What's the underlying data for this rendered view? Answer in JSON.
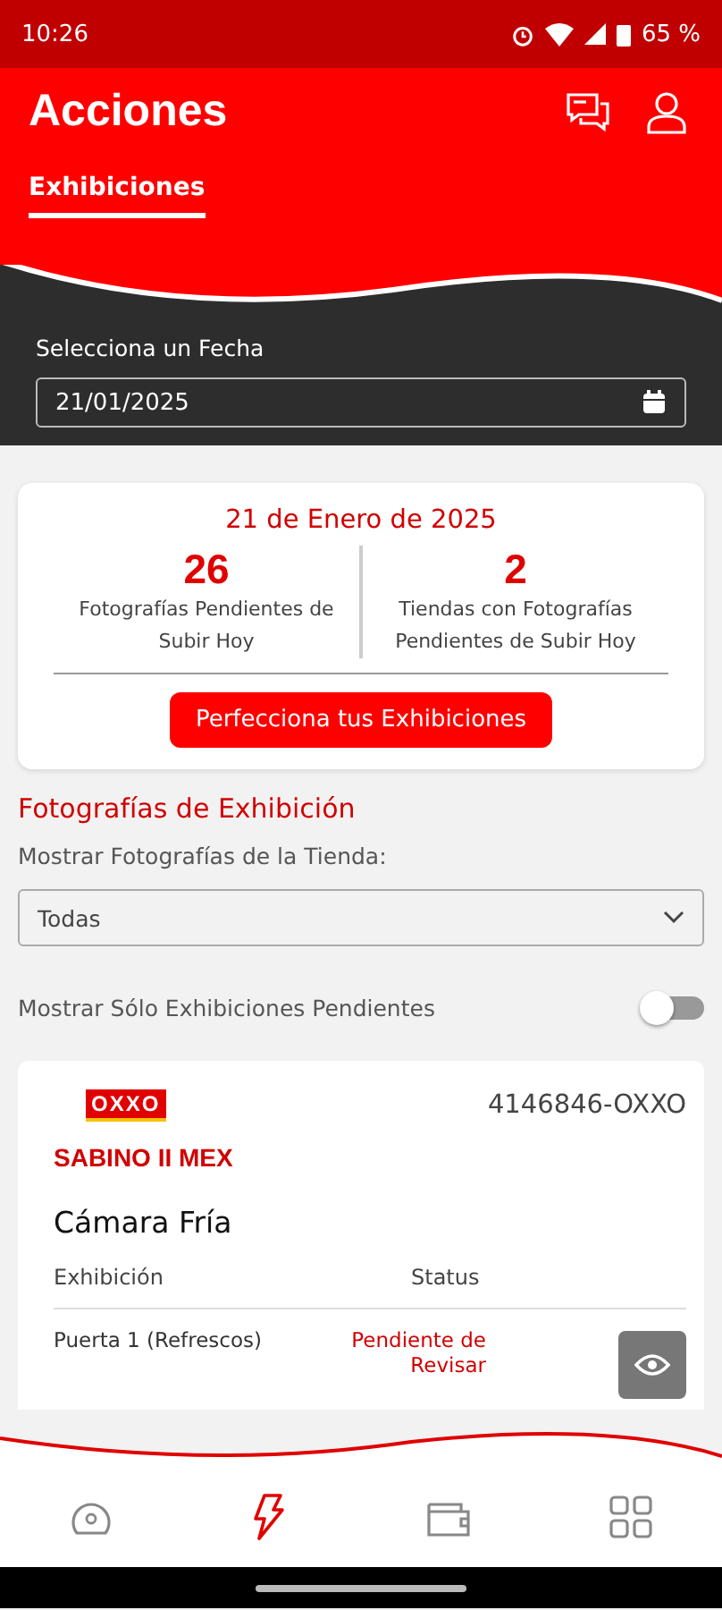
{
  "status_bar": {
    "time": "10:26",
    "battery": "65 %"
  },
  "header": {
    "title": "Acciones",
    "tabs": [
      {
        "label": "Exhibiciones",
        "selected": true
      }
    ]
  },
  "date_picker": {
    "label": "Selecciona un Fecha",
    "value": "21/01/2025"
  },
  "summary": {
    "date": "21 de Enero de 2025",
    "stats": [
      {
        "value": "26",
        "label": "Fotografías Pendientes de Subir Hoy"
      },
      {
        "value": "2",
        "label": "Tiendas con Fotografías Pendientes de Subir Hoy"
      }
    ],
    "button": "Perfecciona tus Exhibiciones"
  },
  "photos": {
    "title": "Fotografías de Exhibición",
    "store_filter": {
      "label": "Mostrar Fotografías de la Tienda:",
      "value": "Todas"
    },
    "pending_toggle": {
      "label": "Mostrar Sólo Exhibiciones Pendientes",
      "on": false
    }
  },
  "store": {
    "logo": "OXXO",
    "code": "4146846-OXXO",
    "name": "SABINO II MEX",
    "section": "Cámara Fría",
    "columns": [
      "Exhibición",
      "Status"
    ],
    "rows": [
      {
        "exhibition": "Puerta 1 (Refrescos)",
        "status": "Pendiente de Revisar"
      }
    ]
  },
  "nav": [
    {
      "kind": "gauge",
      "selected": false
    },
    {
      "kind": "bolt",
      "selected": true
    },
    {
      "kind": "wallet",
      "selected": false
    },
    {
      "kind": "grid",
      "selected": false
    }
  ]
}
